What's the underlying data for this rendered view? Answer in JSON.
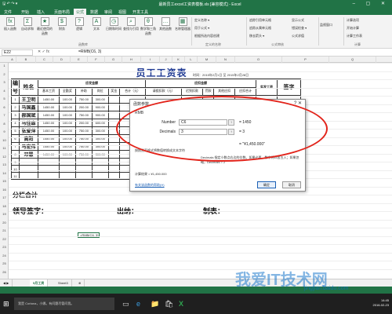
{
  "window": {
    "title": "最新员工excel工资表模板.xls [兼容模式] - Excel",
    "quick_access": "🖫 ↶ ↷ ▾",
    "controls": "– ▢ ✕"
  },
  "tabs": [
    "文件",
    "开始",
    "插入",
    "页面布局",
    "公式",
    "数据",
    "审阅",
    "视图",
    "开发工具"
  ],
  "active_tab": "公式",
  "ribbon": {
    "buttons": [
      {
        "icon": "fx",
        "label": "插入函数"
      },
      {
        "icon": "Σ",
        "label": "自动求和"
      },
      {
        "icon": "★",
        "label": "最近使用的函数"
      },
      {
        "icon": "$",
        "label": "财务"
      },
      {
        "icon": "?",
        "label": "逻辑"
      },
      {
        "icon": "A",
        "label": "文本"
      },
      {
        "icon": "◷",
        "label": "日期和时间"
      },
      {
        "icon": "⌕",
        "label": "查找与引用"
      },
      {
        "icon": "θ",
        "label": "数学和三角函数"
      },
      {
        "icon": "…",
        "label": "其他函数"
      },
      {
        "icon": "▦",
        "label": "名称管理器"
      }
    ],
    "small": [
      "定义名称 ▾",
      "用于公式 ▾",
      "根据所选内容创建",
      "追踪引用单元格",
      "追踪从属单元格",
      "移去箭头 ▾",
      "显示公式",
      "错误检查 ▾",
      "公式求值",
      "监视窗口",
      "计算选项",
      "开始计算",
      "计算工作表"
    ],
    "groups": [
      "函数库",
      "定义的名称",
      "公式审核",
      "计算"
    ]
  },
  "formula_bar": {
    "name_box": "E22",
    "fx": "✕ ✓ fx",
    "formula": "=RMB(C6, 3)"
  },
  "columns": [
    "A",
    "B",
    "C",
    "D",
    "E",
    "F",
    "G",
    "H",
    "I",
    "J",
    "K",
    "L",
    "M",
    "N",
    "O",
    "P",
    "Q"
  ],
  "rows": [
    "1",
    "2",
    "3",
    "4",
    "5",
    "6",
    "7",
    "8",
    "9",
    "10",
    "11",
    "12",
    "13",
    "14",
    "15",
    "16",
    "17",
    "18",
    "19",
    "20",
    "21",
    "22",
    "23",
    "24",
    "25",
    "26"
  ],
  "sheet": {
    "title": "员工工资表",
    "date_text": "时间：2015年2月1日 至 2015年2月28日",
    "headers": {
      "no": "编号",
      "name": "姓名",
      "due": "应发金额",
      "ded": "应扣金额",
      "real": "实发工资",
      "sign": "签字"
    },
    "subheaders": [
      "基本工资",
      "全勤奖",
      "补助",
      "岗位",
      "奖金",
      "合计（元）",
      "请假扣款（元）",
      "迟到扣款",
      "罚款",
      "其他应扣",
      "应扣合计"
    ],
    "employees": [
      {
        "no": "1",
        "name": "王卫明",
        "basic": "1450.00",
        "attend": "100.00",
        "sub": "750.00",
        "post": "300.00"
      },
      {
        "no": "2",
        "name": "马国鑫",
        "basic": "1450.00",
        "attend": "100.00",
        "sub": "200.00",
        "post": "900.00"
      },
      {
        "no": "3",
        "name": "郝国斌",
        "basic": "1450.00",
        "attend": "100.00",
        "sub": "750.00",
        "post": "900.00"
      },
      {
        "no": "4",
        "name": "马佳森",
        "basic": "1450.00",
        "attend": "100.00",
        "sub": "200.00",
        "post": "600.00"
      },
      {
        "no": "5",
        "name": "张爱萍",
        "basic": "1450.00",
        "attend": "100.00",
        "sub": "750.00",
        "post": "300.00"
      },
      {
        "no": "6",
        "name": "高阳",
        "basic": "1450.00",
        "attend": "100.00",
        "sub": "750.00",
        "post": "300.00"
      },
      {
        "no": "7",
        "name": "马宏伟",
        "basic": "1450.00",
        "attend": "100.00",
        "sub": "750.00",
        "post": "300.00"
      },
      {
        "no": "8",
        "name": "邓慧",
        "basic": "1450.00",
        "attend": "100.00",
        "sub": "750.00",
        "post": "300.00"
      }
    ],
    "empty_rows": [
      "9",
      "10",
      "11"
    ],
    "total_label": "分栏合计",
    "signatures": [
      "领导签字：",
      "出纳：",
      "制表："
    ],
    "active_cell_text": "=RMB(C6, 3)"
  },
  "dialog": {
    "title": "函数参数",
    "close": "?  ✕",
    "fn": "RMB",
    "args": [
      {
        "label": "Number",
        "value": "C6",
        "result": "= 1450"
      },
      {
        "label": "Decimals",
        "value": "3",
        "result": "= 3"
      }
    ],
    "preview": "= \"¥1,450.000\"",
    "desc": "按照货币格式将数值转换成文本字符",
    "desc2": "Decimals 指定小数点右边的位数。如果必要，数字将四舍五入；如果忽略，Decimals = 2",
    "result": "计算结果 = ¥1,450.000",
    "help": "有关该函数的帮助(H)",
    "ok": "确定",
    "cancel": "取消"
  },
  "sheet_tabs": [
    "5月工资",
    "Sheet3"
  ],
  "taskbar": {
    "start": "⊞",
    "search": "我是 Cortana，小娜。有问题尽管问我。",
    "icons": [
      "▭",
      "e",
      "📁",
      "🛍",
      "X"
    ],
    "time": "14:45",
    "date": "2016-02-23"
  },
  "watermark": {
    "text": "我爱IT技术网",
    "url": "jingyan.baidu.com"
  }
}
